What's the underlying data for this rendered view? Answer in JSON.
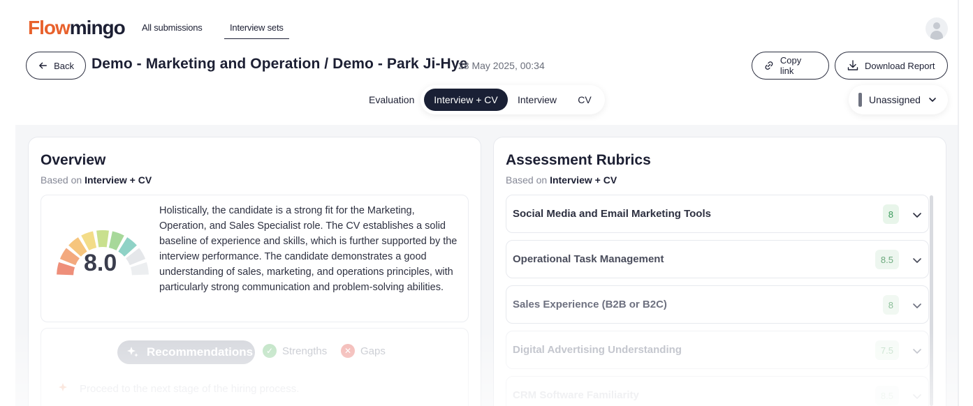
{
  "brand": {
    "logo_part1": "Flow",
    "logo_part2": "mingo"
  },
  "nav": {
    "tabs": [
      {
        "label": "All submissions"
      },
      {
        "label": "Interview sets"
      }
    ]
  },
  "header": {
    "back_label": "Back",
    "title": "Demo - Marketing and Operation / Demo - Park Ji-Hye",
    "date": "28 May 2025, 00:34",
    "copy_link_label": "Copy link",
    "download_label": "Download Report"
  },
  "view_tabs": {
    "evaluation": "Evaluation",
    "items": [
      "Interview + CV",
      "Interview",
      "CV"
    ],
    "active": "Interview + CV"
  },
  "assignee": {
    "label": "Unassigned"
  },
  "overview": {
    "title": "Overview",
    "based_on_prefix": "Based on",
    "based_on_value": "Interview + CV",
    "score": "8.0",
    "score_value": 8.0,
    "summary": "Holistically, the candidate is a strong fit for the Marketing, Operation, and Sales Specialist role. The CV establishes a solid baseline of experience and skills, which is further supported by the interview performance. The candidate demonstrates a good understanding of sales, marketing, and operations principles, with particularly strong communication and problem-solving abilities.",
    "tabs": {
      "recommendations": "Recommendations",
      "strengths": "Strengths",
      "gaps": "Gaps"
    },
    "recommendation_item": "Proceed to the next stage of the hiring process."
  },
  "rubrics": {
    "title": "Assessment Rubrics",
    "based_on_prefix": "Based on",
    "based_on_value": "Interview + CV",
    "items": [
      {
        "label": "Social Media and Email Marketing Tools",
        "score": "8"
      },
      {
        "label": "Operational Task Management",
        "score": "8.5"
      },
      {
        "label": "Sales Experience (B2B or B2C)",
        "score": "8"
      },
      {
        "label": "Digital Advertising Understanding",
        "score": "7.5"
      },
      {
        "label": "CRM Software Familiarity",
        "score": "8.5"
      }
    ]
  },
  "colors": {
    "brand_orange": "#e8612c",
    "navy": "#1a2035",
    "score_green": "#2e8b57",
    "score_bg": "#eaf6ec",
    "gauge_segments": [
      "#ee8f7a",
      "#f3a97e",
      "#f6c57d",
      "#f3dc88",
      "#c9e08e",
      "#a7d89a",
      "#8fd2c6",
      "#e5e7ea",
      "#eceef0"
    ]
  }
}
